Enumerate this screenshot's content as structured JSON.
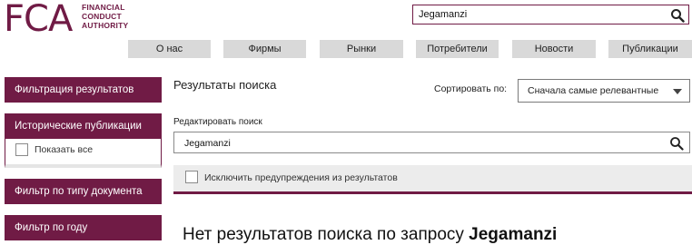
{
  "brand": {
    "logo_mark": "FCA",
    "logo_line1": "FINANCIAL",
    "logo_line2": "CONDUCT",
    "logo_line3": "AUTHORITY",
    "accent_color": "#701b45",
    "nav_bg_color": "#d9d9d9"
  },
  "header": {
    "search_value": "Jegamanzi",
    "search_icon": "search-icon"
  },
  "nav": {
    "items": [
      "О нас",
      "Фирмы",
      "Рынки",
      "Потребители",
      "Новости",
      "Публикации"
    ]
  },
  "sidebar": {
    "filter_results": "Фильтрация результатов",
    "historical": "Исторические публикации",
    "show_all": "Показать все",
    "show_all_checked": false,
    "doc_type": "Фильтр по типу документа",
    "year": "Фильтр по году"
  },
  "main": {
    "results_title": "Результаты поиска",
    "sort_label": "Сортировать по:",
    "sort_value": "Сначала самые релевантные",
    "edit_label": "Редактировать поиск",
    "search_value": "Jegamanzi",
    "exclude_label": "Исключить предупреждения из результатов",
    "exclude_checked": false,
    "no_results_prefix": "Нет результатов поиска по запросу ",
    "no_results_query": "Jegamanzi"
  }
}
